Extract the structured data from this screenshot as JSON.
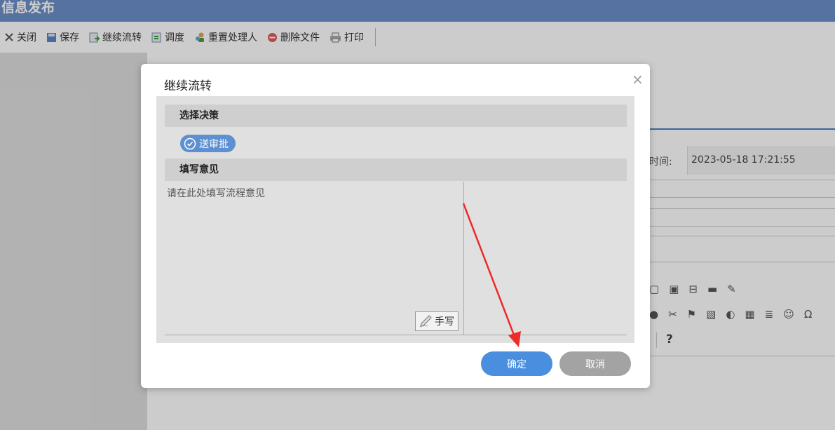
{
  "page": {
    "title": "信息发布",
    "toolbar": [
      {
        "label": "关闭",
        "icon": "close-icon"
      },
      {
        "label": "保存",
        "icon": "save-icon"
      },
      {
        "label": "继续流转",
        "icon": "forward-icon"
      },
      {
        "label": "调度",
        "icon": "dispatch-icon"
      },
      {
        "label": "重置处理人",
        "icon": "reset-handler-icon"
      },
      {
        "label": "删除文件",
        "icon": "delete-icon"
      },
      {
        "label": "打印",
        "icon": "print-icon"
      }
    ],
    "form": {
      "time_label": "时间:",
      "time_value": "2023-05-18 17:21:55"
    },
    "editor_help": "?"
  },
  "dialog": {
    "title": "继续流转",
    "close_label": "×",
    "decision_section": "选择决策",
    "decision_option": "送审批",
    "opinion_section": "填写意见",
    "opinion_placeholder": "请在此处填写流程意见",
    "handwrite_label": "手写",
    "confirm_label": "确定",
    "cancel_label": "取消"
  },
  "colors": {
    "title_bar": "#6c8fc8",
    "primary": "#4a8fdf",
    "decision": "#5d8fd3",
    "cancel": "#a3a3a3",
    "annotation_arrow": "#ee2a2a"
  }
}
